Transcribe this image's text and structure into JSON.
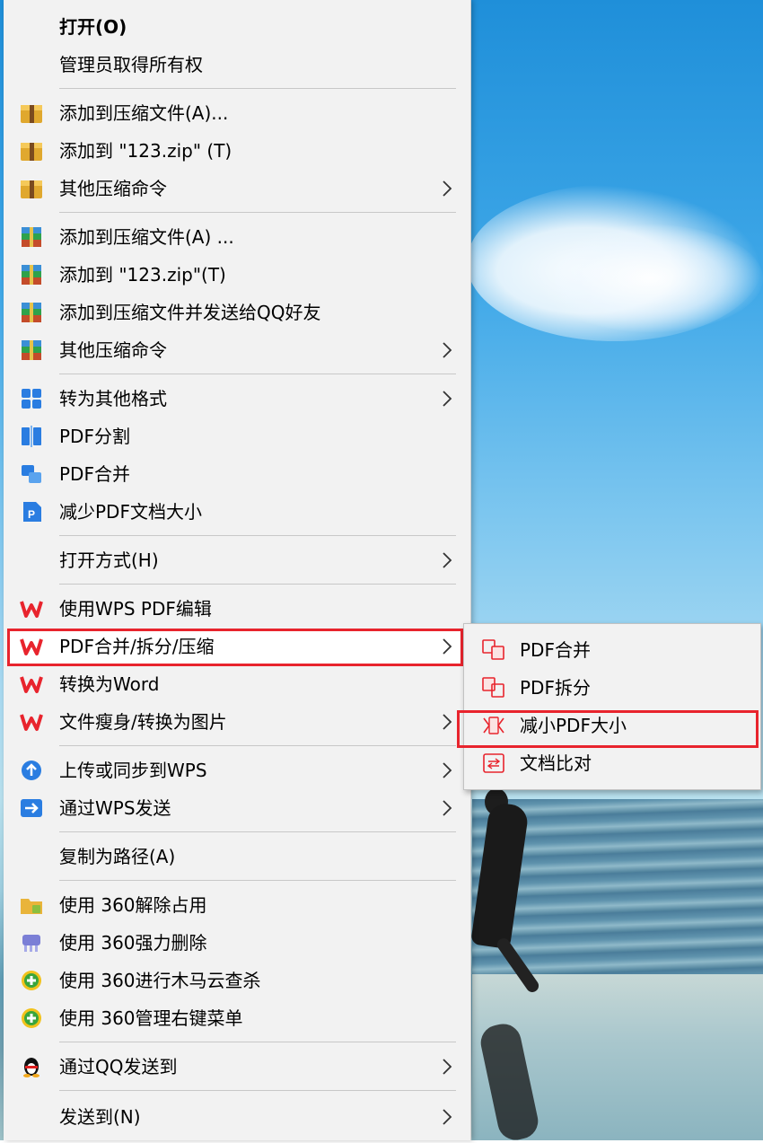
{
  "menu": {
    "items": [
      {
        "label": "打开(O)"
      },
      {
        "label": "管理员取得所有权"
      },
      {
        "label": "添加到压缩文件(A)..."
      },
      {
        "label": "添加到 \"123.zip\" (T)"
      },
      {
        "label": "其他压缩命令"
      },
      {
        "label": "添加到压缩文件(A) ..."
      },
      {
        "label": "添加到 \"123.zip\"(T)"
      },
      {
        "label": "添加到压缩文件并发送给QQ好友"
      },
      {
        "label": "其他压缩命令"
      },
      {
        "label": "转为其他格式"
      },
      {
        "label": "PDF分割"
      },
      {
        "label": "PDF合并"
      },
      {
        "label": "减少PDF文档大小"
      },
      {
        "label": "打开方式(H)"
      },
      {
        "label": "使用WPS PDF编辑"
      },
      {
        "label": "PDF合并/拆分/压缩"
      },
      {
        "label": "转换为Word"
      },
      {
        "label": "文件瘦身/转换为图片"
      },
      {
        "label": "上传或同步到WPS"
      },
      {
        "label": "通过WPS发送"
      },
      {
        "label": "复制为路径(A)"
      },
      {
        "label": "使用 360解除占用"
      },
      {
        "label": "使用 360强力删除"
      },
      {
        "label": "使用 360进行木马云查杀"
      },
      {
        "label": "使用 360管理右键菜单"
      },
      {
        "label": "通过QQ发送到"
      },
      {
        "label": "发送到(N)"
      }
    ]
  },
  "submenu": {
    "items": [
      {
        "label": "PDF合并"
      },
      {
        "label": "PDF拆分"
      },
      {
        "label": "减小PDF大小"
      },
      {
        "label": "文档比对"
      }
    ]
  },
  "colors": {
    "highlight_border": "#e8242d",
    "wps_red": "#e8242d",
    "menu_bg": "#f2f2f2",
    "wps_blue": "#1e7de0"
  }
}
